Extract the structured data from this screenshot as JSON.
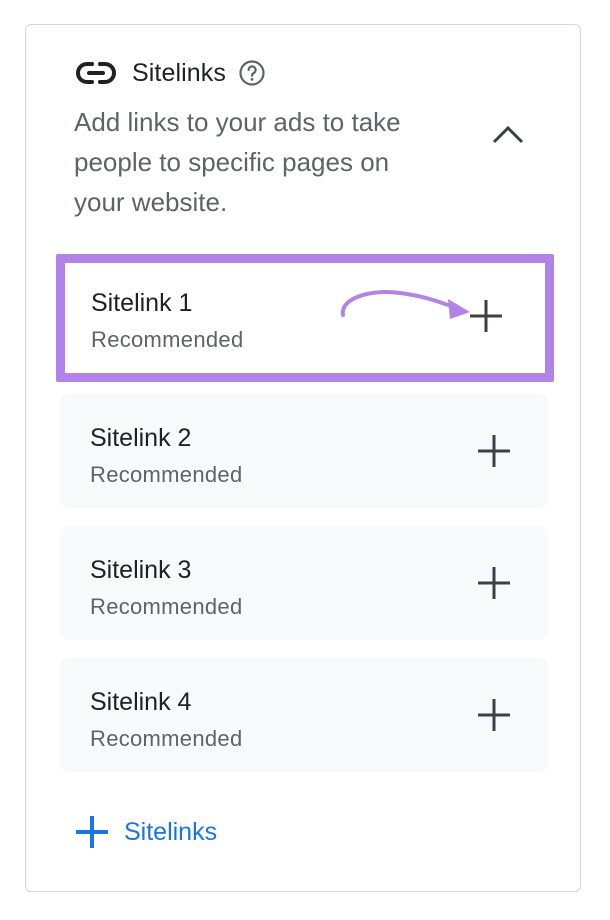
{
  "panel": {
    "title": "Sitelinks",
    "description": "Add links to your ads to take people to specific pages on your website.",
    "icons": {
      "header": "link-icon",
      "help": "help-icon",
      "collapse": "chevron-up-icon",
      "add": "plus-icon"
    }
  },
  "sitelinks": [
    {
      "name": "Sitelink 1",
      "status": "Recommended"
    },
    {
      "name": "Sitelink 2",
      "status": "Recommended"
    },
    {
      "name": "Sitelink 3",
      "status": "Recommended"
    },
    {
      "name": "Sitelink 4",
      "status": "Recommended"
    }
  ],
  "add_button": {
    "label": "Sitelinks"
  },
  "colors": {
    "highlight": "#b183e8",
    "accent": "#1a73e8",
    "item_background": "#f8f9fa"
  }
}
